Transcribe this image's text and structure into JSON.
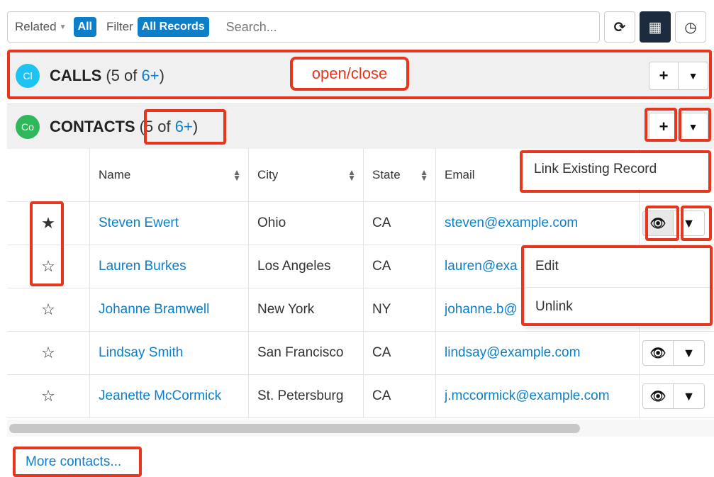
{
  "toolbar": {
    "related_label": "Related",
    "related_value": "All",
    "filter_label": "Filter",
    "filter_value": "All Records",
    "search_placeholder": "Search..."
  },
  "calls": {
    "icon_text": "Cl",
    "title": "CALLS",
    "count_prefix": "(5 of ",
    "count_more": "6+",
    "count_suffix": ")"
  },
  "contacts": {
    "icon_text": "Co",
    "title": "CONTACTS",
    "count_prefix": "(5 of ",
    "count_more": "6+",
    "count_suffix": ")",
    "columns": [
      "Name",
      "City",
      "State",
      "Email"
    ],
    "rows": [
      {
        "name": "Steven Ewert",
        "city": "Ohio",
        "state": "CA",
        "email": "steven@example.com",
        "favorite": true
      },
      {
        "name": "Lauren Burkes",
        "city": "Los Angeles",
        "state": "CA",
        "email": "lauren@exa",
        "favorite": false
      },
      {
        "name": "Johanne Bramwell",
        "city": "New York",
        "state": "NY",
        "email": "johanne.b@",
        "favorite": false
      },
      {
        "name": "Lindsay Smith",
        "city": "San Francisco",
        "state": "CA",
        "email": "lindsay@example.com",
        "favorite": false
      },
      {
        "name": "Jeanette McCormick",
        "city": "St. Petersburg",
        "state": "CA",
        "email": "j.mccormick@example.com",
        "favorite": false
      }
    ],
    "more_link": "More contacts..."
  },
  "menus": {
    "link_existing": "Link Existing Record",
    "row_edit": "Edit",
    "row_unlink": "Unlink"
  },
  "annotations": {
    "open_close": "open/close"
  },
  "colors": {
    "accent": "#0d7ec8",
    "annotation": "#e8361e",
    "calls_icon": "#1fc3f2",
    "contacts_icon": "#2fb85a"
  }
}
